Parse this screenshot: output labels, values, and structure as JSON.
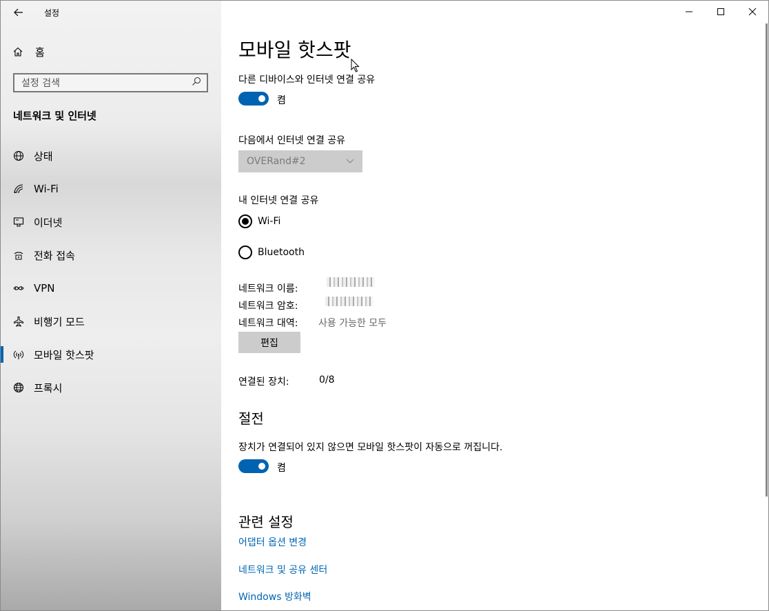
{
  "app": {
    "title": "설정"
  },
  "sidebar": {
    "home_label": "홈",
    "search_placeholder": "설정 검색",
    "section_title": "네트워크 및 인터넷",
    "items": [
      {
        "label": "상태",
        "icon": "globe-status-icon"
      },
      {
        "label": "Wi-Fi",
        "icon": "wifi-icon"
      },
      {
        "label": "이더넷",
        "icon": "ethernet-icon"
      },
      {
        "label": "전화 접속",
        "icon": "dialup-icon"
      },
      {
        "label": "VPN",
        "icon": "vpn-icon"
      },
      {
        "label": "비행기 모드",
        "icon": "airplane-icon"
      },
      {
        "label": "모바일 핫스팟",
        "icon": "hotspot-icon",
        "active": true
      },
      {
        "label": "프록시",
        "icon": "globe-proxy-icon"
      }
    ]
  },
  "main": {
    "title": "모바일 핫스팟",
    "share_label": "다른 디바이스와 인터넷 연결 공유",
    "share_state": "켬",
    "from_label": "다음에서 인터넷 연결 공유",
    "from_value": "OVERand#2",
    "over_label": "내 인터넷 연결 공유",
    "radio_wifi": "Wi-Fi",
    "radio_bt": "Bluetooth",
    "net_name_label": "네트워크 이름:",
    "net_pw_label": "네트워크 암호:",
    "net_band_label": "네트워크 대역:",
    "net_band_value": "사용 가능한 모두",
    "edit_label": "편집",
    "connected_label": "연결된 장치:",
    "connected_value": "0/8",
    "power_title": "절전",
    "power_desc": "장치가 연결되어 있지 않으면 모바일 핫스팟이 자동으로 꺼집니다.",
    "power_state": "켬",
    "related_title": "관련 설정",
    "links": [
      "어댑터 옵션 변경",
      "네트워크 및 공유 센터",
      "Windows 방화벽"
    ]
  },
  "colors": {
    "accent": "#0063b1",
    "link": "#0066b4"
  }
}
